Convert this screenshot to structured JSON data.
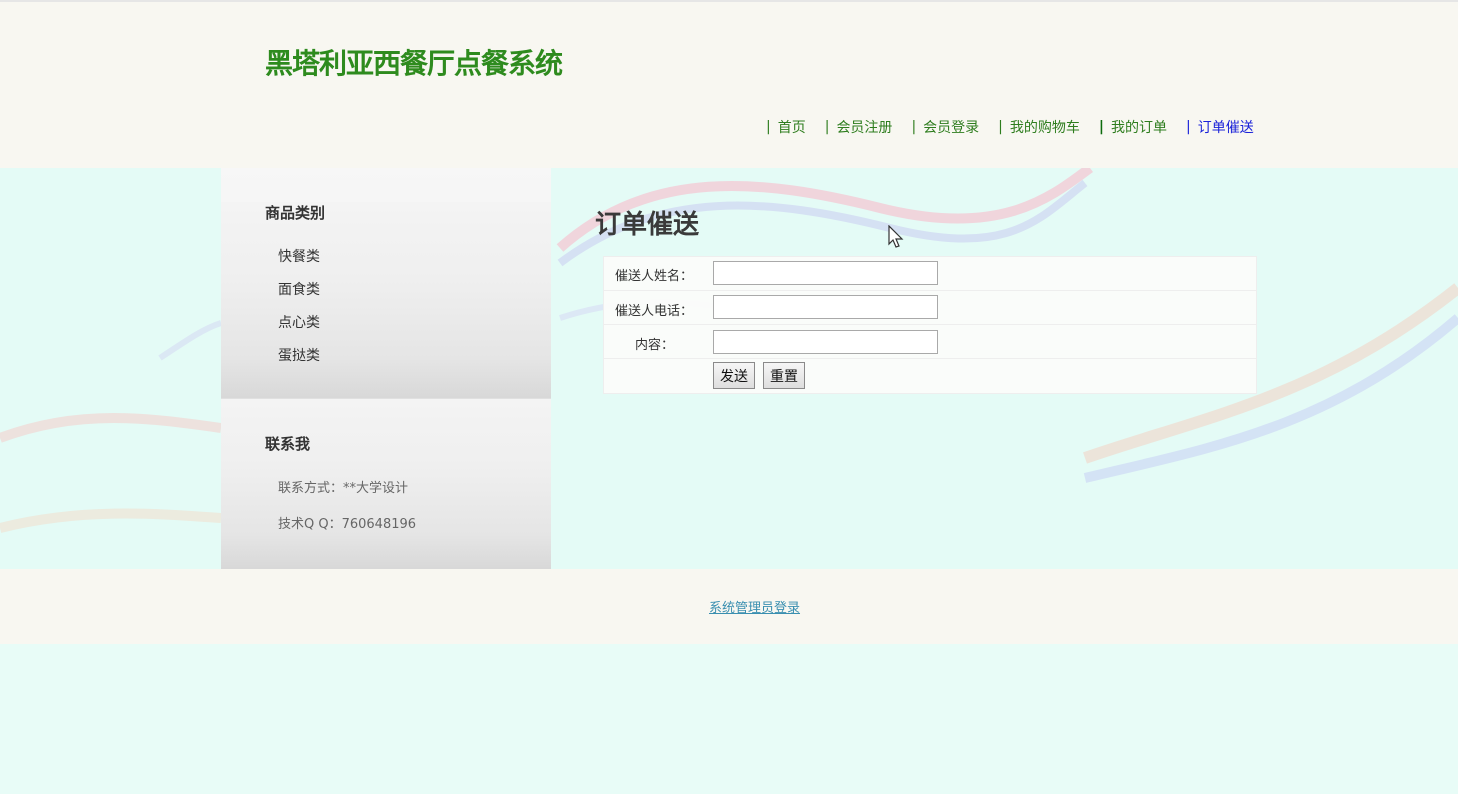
{
  "header": {
    "site_title": "黑塔利亚西餐厅点餐系统",
    "nav": [
      {
        "label": "首页"
      },
      {
        "label": "会员注册"
      },
      {
        "label": "会员登录"
      },
      {
        "label": "我的购物车"
      },
      {
        "label": "我的订单"
      },
      {
        "label": "订单催送"
      }
    ],
    "nav_separator": "|"
  },
  "sidebar": {
    "categories_heading": "商品类别",
    "categories": [
      {
        "label": "快餐类"
      },
      {
        "label": "面食类"
      },
      {
        "label": "点心类"
      },
      {
        "label": "蛋挞类"
      }
    ],
    "contact_heading": "联系我",
    "contact_lines": [
      {
        "text": "联系方式：**大学设计"
      },
      {
        "text": "技术Q Q：760648196"
      }
    ]
  },
  "content": {
    "title": "订单催送",
    "form": {
      "name_label": "催送人姓名：",
      "name_value": "",
      "phone_label": "催送人电话：",
      "phone_value": "",
      "content_label": "内容：",
      "content_value": "",
      "submit_label": "发送",
      "reset_label": "重置"
    }
  },
  "footer": {
    "admin_login": "系统管理员登录"
  },
  "colors": {
    "brand_green": "#2e8b1e",
    "nav_active": "#1a22d9",
    "page_bg": "#e4fbf6",
    "header_bg": "#f8f7f1"
  }
}
